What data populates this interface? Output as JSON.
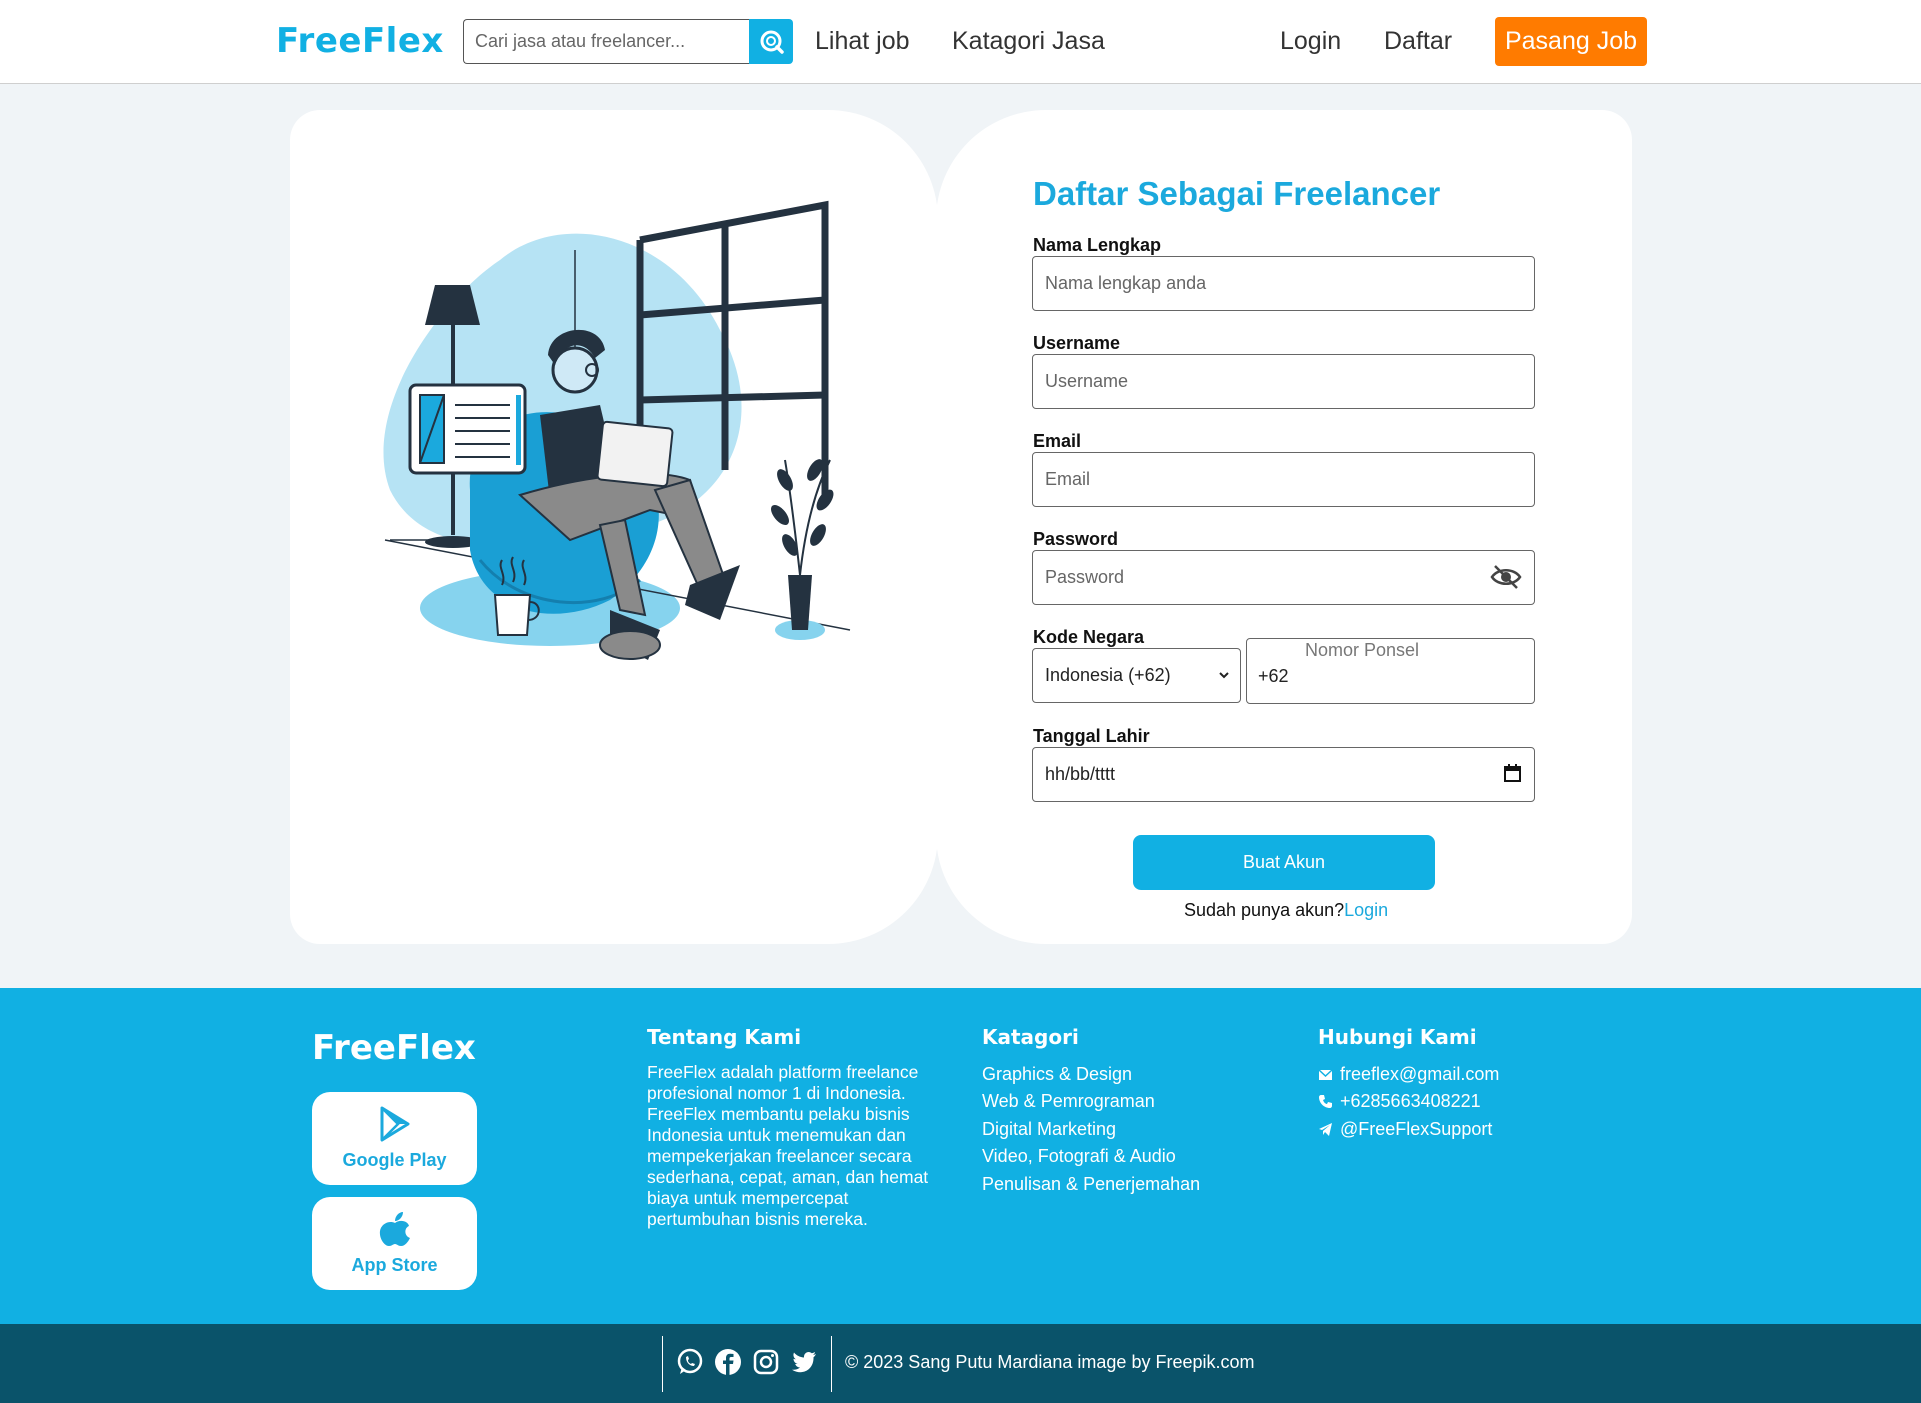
{
  "header": {
    "logo": "FreeFlex",
    "search_placeholder": "Cari jasa atau freelancer...",
    "nav": [
      "Lihat job",
      "Katagori Jasa"
    ],
    "login": "Login",
    "daftar": "Daftar",
    "post_job": "Pasang Job"
  },
  "form": {
    "title": "Daftar Sebagai Freelancer",
    "name_label": "Nama Lengkap",
    "name_placeholder": "Nama lengkap anda",
    "username_label": "Username",
    "username_placeholder": "Username",
    "email_label": "Email",
    "email_placeholder": "Email",
    "password_label": "Password",
    "password_placeholder": "Password",
    "country_label": "Kode Negara",
    "country_value": "Indonesia (+62)",
    "phone_legend": "Nomor Ponsel",
    "phone_value": "+62",
    "birth_label": "Tanggal Lahir",
    "birth_value": "hh/bb/tttt",
    "submit": "Buat Akun",
    "have_account": "Sudah punya akun?",
    "login_link": "Login"
  },
  "footer": {
    "logo": "FreeFlex",
    "google_play": "Google Play",
    "app_store": "App Store",
    "about_title": "Tentang Kami",
    "about_text": "FreeFlex adalah platform freelance profesional nomor 1 di Indonesia. FreeFlex membantu pelaku bisnis Indonesia untuk menemukan dan mempekerjakan freelancer secara sederhana, cepat, aman, dan hemat biaya untuk mempercepat pertumbuhan bisnis mereka.",
    "category_title": "Katagori",
    "categories": [
      "Graphics & Design",
      "Web & Pemrograman",
      "Digital Marketing",
      "Video, Fotografi & Audio",
      "Penulisan & Penerjemahan"
    ],
    "contact_title": "Hubungi Kami",
    "email": "freeflex@gmail.com",
    "phone": "+6285663408221",
    "telegram": "@FreeFlexSupport",
    "copyright": "© 2023 Sang Putu Mardiana image by Freepik.com"
  },
  "colors": {
    "primary": "#11b0e3",
    "accent": "#ff7b00",
    "dark": "#0a536a"
  }
}
